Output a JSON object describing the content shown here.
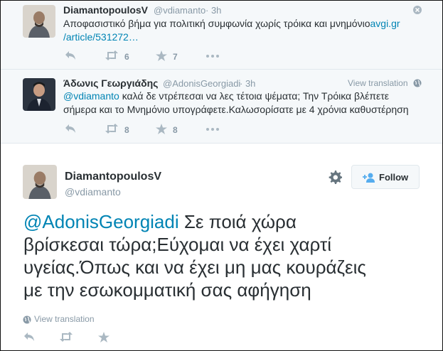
{
  "tweet1": {
    "name": "DiamantopoulosV",
    "handle": "@vdiamanto",
    "time": "· 3h",
    "text": "Αποφασιστικό βήμα για πολιτική συμφωνία χωρίς τρόικα και μνημόνιο",
    "link_line1": "avgi.gr",
    "link_line2": "/article/531272…",
    "retweets": "6",
    "favorites": "7"
  },
  "tweet2": {
    "name": "Άδωνις Γεωργιάδης",
    "handle": "@AdonisGeorgiadi",
    "time": "· 3h",
    "view_translation": "View translation",
    "mention": "@vdiamanto",
    "text_line1": " καλά δε ντρέπεσαι να λες τέτοια ψέματα; Την Τρόικα βλέπετε",
    "text_line2": "σήμερα και το Μνημόνιο υπογράφετε.Καλωσορίσατε με 4 χρόνια καθυστέρηση",
    "retweets": "8",
    "favorites": "8"
  },
  "main_tweet": {
    "name": "DiamantopoulosV",
    "handle": "@vdiamanto",
    "follow_label": "Follow",
    "mention": "@AdonisGeorgiadi",
    "line1": " Σε ποιά χώρα",
    "line2": "βρίσκεσαι τώρα;Εύχομαι να έχει χαρτί",
    "line3": "υγείας.Όπως και να έχει μη μας κουράζεις",
    "line4": "με την εσωκομματική σας αφήγηση",
    "view_translation": "View translation"
  },
  "icons": {
    "reply": "reply-icon",
    "retweet": "retweet-icon",
    "favorite": "star-icon",
    "more": "more-icon",
    "close": "close-icon",
    "globe": "globe-icon",
    "gear": "gear-icon",
    "follow": "add-user-icon"
  },
  "colors": {
    "link": "#0084b4",
    "muted": "#8899a6",
    "context_bg": "#f5f8fa"
  }
}
